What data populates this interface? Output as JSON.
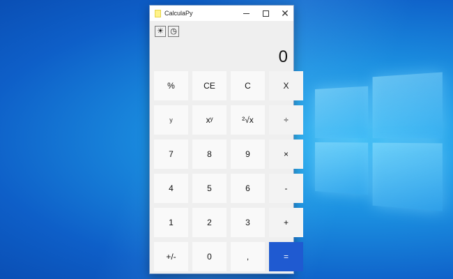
{
  "window": {
    "title": "CalculaPy",
    "min_symbol": "",
    "close_symbol": "✕"
  },
  "toolbar": {
    "theme_icon": "☀",
    "history_icon": "◷"
  },
  "display": {
    "value": "0"
  },
  "keys": [
    {
      "label": "%",
      "name": "percent-button"
    },
    {
      "label": "CE",
      "name": "clear-entry-button"
    },
    {
      "label": "C",
      "name": "clear-button"
    },
    {
      "label": "X",
      "name": "backspace-button"
    },
    {
      "label": "y",
      "name": "y-button"
    },
    {
      "label": "xʸ",
      "name": "power-button"
    },
    {
      "label": "²√x",
      "name": "square-root-button"
    },
    {
      "label": "÷",
      "name": "divide-button"
    },
    {
      "label": "7",
      "name": "digit-7-button"
    },
    {
      "label": "8",
      "name": "digit-8-button"
    },
    {
      "label": "9",
      "name": "digit-9-button"
    },
    {
      "label": "×",
      "name": "multiply-button"
    },
    {
      "label": "4",
      "name": "digit-4-button"
    },
    {
      "label": "5",
      "name": "digit-5-button"
    },
    {
      "label": "6",
      "name": "digit-6-button"
    },
    {
      "label": "-",
      "name": "subtract-button"
    },
    {
      "label": "1",
      "name": "digit-1-button"
    },
    {
      "label": "2",
      "name": "digit-2-button"
    },
    {
      "label": "3",
      "name": "digit-3-button"
    },
    {
      "label": "+",
      "name": "add-button"
    },
    {
      "label": "+/-",
      "name": "negate-button"
    },
    {
      "label": "0",
      "name": "digit-0-button"
    },
    {
      "label": ",",
      "name": "decimal-button"
    },
    {
      "label": "=",
      "name": "equals-button"
    }
  ],
  "colors": {
    "equals_bg": "#1f5ad1",
    "desktop": "#1b8fe0"
  }
}
